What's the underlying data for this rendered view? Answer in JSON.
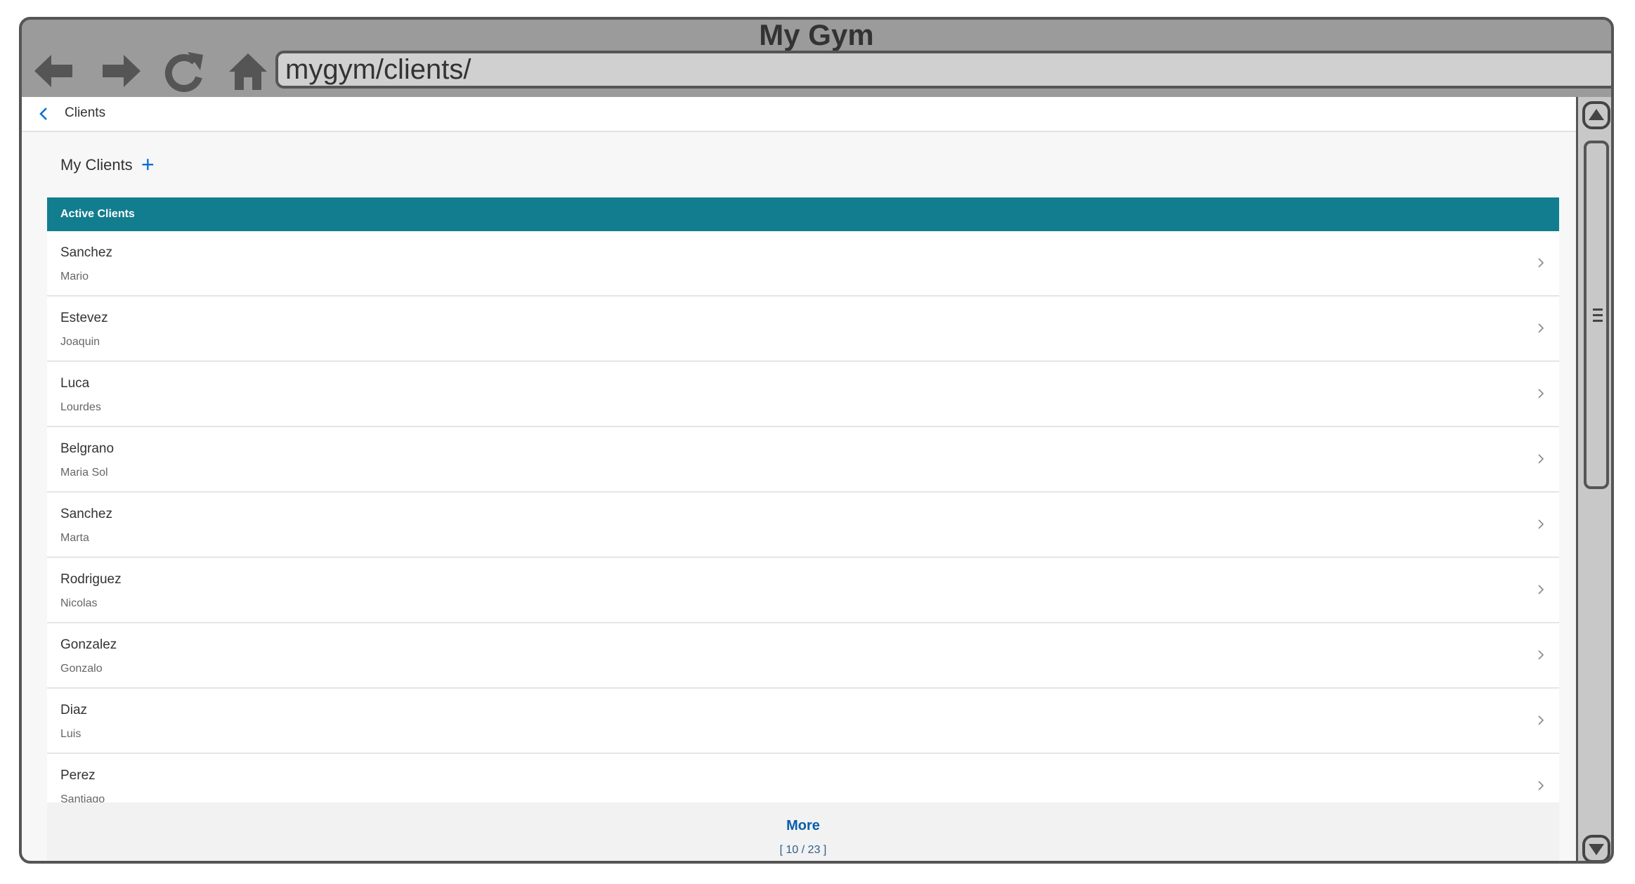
{
  "browser": {
    "title": "My Gym",
    "url": "mygym/clients/"
  },
  "page": {
    "breadcrumb": "Clients",
    "section_title": "My Clients",
    "add_label": "+"
  },
  "list": {
    "header": "Active Clients",
    "items": [
      {
        "title": "Sanchez",
        "description": "Mario"
      },
      {
        "title": "Estevez",
        "description": "Joaquin"
      },
      {
        "title": "Luca",
        "description": "Lourdes"
      },
      {
        "title": "Belgrano",
        "description": "Maria Sol"
      },
      {
        "title": "Sanchez",
        "description": "Marta"
      },
      {
        "title": "Rodriguez",
        "description": "Nicolas"
      },
      {
        "title": "Gonzalez",
        "description": "Gonzalo"
      },
      {
        "title": "Diaz",
        "description": "Luis"
      },
      {
        "title": "Perez",
        "description": "Santiago"
      }
    ],
    "more_label": "More",
    "count_label": "[ 10 / 23 ]"
  },
  "colors": {
    "header_bg": "#127d8e",
    "link": "#0a5ea8"
  },
  "icons": [
    "back-arrow-icon",
    "forward-arrow-icon",
    "reload-icon",
    "home-icon",
    "chevron-left-icon",
    "chevron-right-icon",
    "scroll-up-icon",
    "scroll-down-icon"
  ]
}
